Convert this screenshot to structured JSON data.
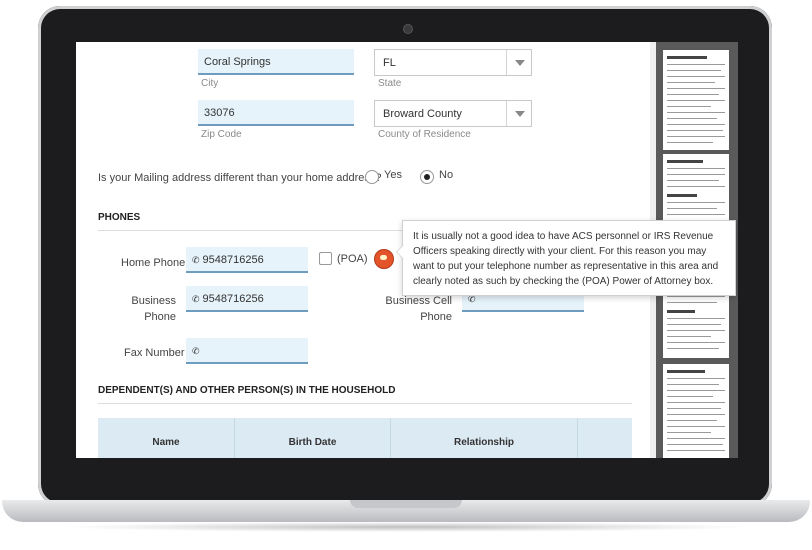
{
  "address": {
    "city_value": "Coral Springs",
    "city_label": "City",
    "state_value": "FL",
    "state_label": "State",
    "zip_value": "33076",
    "zip_label": "Zip Code",
    "county_value": "Broward County",
    "county_label": "County of Residence"
  },
  "mailing": {
    "question": "Is your Mailing address different than your home address?",
    "yes_label": "Yes",
    "no_label": "No",
    "selected": "No"
  },
  "phones": {
    "heading": "PHONES",
    "home_label": "Home Phone",
    "home_value": "9548716256",
    "poa_label": "(POA)",
    "business_label_1": "Business",
    "business_label_2": "Phone",
    "business_value": "9548716256",
    "business_cell_label_1": "Business Cell",
    "business_cell_label_2": "Phone",
    "fax_label": "Fax Number",
    "fax_value": ""
  },
  "tooltip": {
    "text": "It is usually not a good idea to have ACS personnel or IRS Revenue Officers speaking directly with your client. For this reason you may want to put your telephone number as representative in this area and clearly noted as such by checking the (POA) Power of Attorney box."
  },
  "dependents": {
    "heading": "DEPENDENT(S) AND OTHER PERSON(S) IN THE HOUSEHOLD",
    "columns": [
      "Name",
      "Birth Date",
      "Relationship"
    ]
  },
  "icons": {
    "phone": "phone-icon",
    "select_arrow": "chevron-down-icon",
    "mascot": "mascot-icon"
  },
  "colors": {
    "input_bg": "#e6f3fb",
    "input_border": "#6d9cbf",
    "table_header_bg": "#dceaf4",
    "thumbnail_panel_bg": "#5a5a5a"
  }
}
